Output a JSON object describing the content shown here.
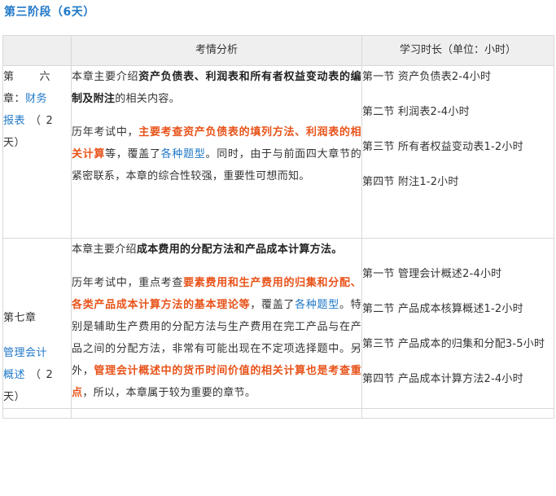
{
  "stage": {
    "title": "第三阶段（6天）"
  },
  "table": {
    "headers": {
      "chapter": "",
      "analysis": "考情分析",
      "time": "学习时长（单位：小时）"
    },
    "rows": [
      {
        "chapter": {
          "line1a": "第",
          "line1b": "六",
          "line2a": "章：",
          "line2b": "财务",
          "line3a": "报表",
          "line3b": "（",
          "line3c": "2",
          "line4": "天）"
        },
        "analysis": {
          "p1": {
            "t1": "本章主要介绍",
            "b1": "资产负债表、利润表和所有者权益变动表的编制及附注",
            "t2": "的相关内容。"
          },
          "p2": {
            "t1": "历年考试中，",
            "o1": "主要考查资产负债表的填列方法、利润表的相关计算",
            "t2": "等，覆盖了",
            "l1": "各种题型",
            "t3": "。同时，由于与前面四大章节的紧密联系，本章的综合性较强，重要性可想而知。"
          }
        },
        "time": [
          "第一节 资产负债表2-4小时",
          "第二节 利润表2-4小时",
          "第三节 所有者权益变动表1-2小时",
          "第四节 附注1-2小时"
        ]
      },
      {
        "chapter": {
          "line1": "第七章",
          "line2": "管理会计",
          "line3a": "概述",
          "line3b": "（",
          "line3c": "2",
          "line4": "天）"
        },
        "analysis": {
          "p1": {
            "t1": "本章主要介绍",
            "b1": "成本费用的分配方法和产品成本计算方法。",
            "t2": ""
          },
          "p2": {
            "t1": "历年考试中，重点考查",
            "o1": "要素费用和生产费用的归集和分配、各类产品成本计算方法的基本理论等",
            "t2": "，覆盖了",
            "l1": "各种题型",
            "t3": "。特别是辅助生产费用的分配方法与生产费用在完工产品与在产品之间的分配方法，非常有可能出现在不定项选择题中。另外，",
            "o2": "管理会计概述中的货币时间价值的相关计算也是考查重点",
            "t4": "，所以，本章属于较为重要的章节。"
          }
        },
        "time": [
          "第一节 管理会计概述2-4小时",
          "第二节 产品成本核算概述1-2小时",
          "第三节 产品成本的归集和分配3-5小时",
          "第四节 产品成本计算方法2-4小时"
        ]
      }
    ]
  },
  "colors": {
    "accent": "#1f78c8",
    "highlight": "#e8531a",
    "header_bg": "#efefef",
    "border": "#d8d8d8"
  }
}
